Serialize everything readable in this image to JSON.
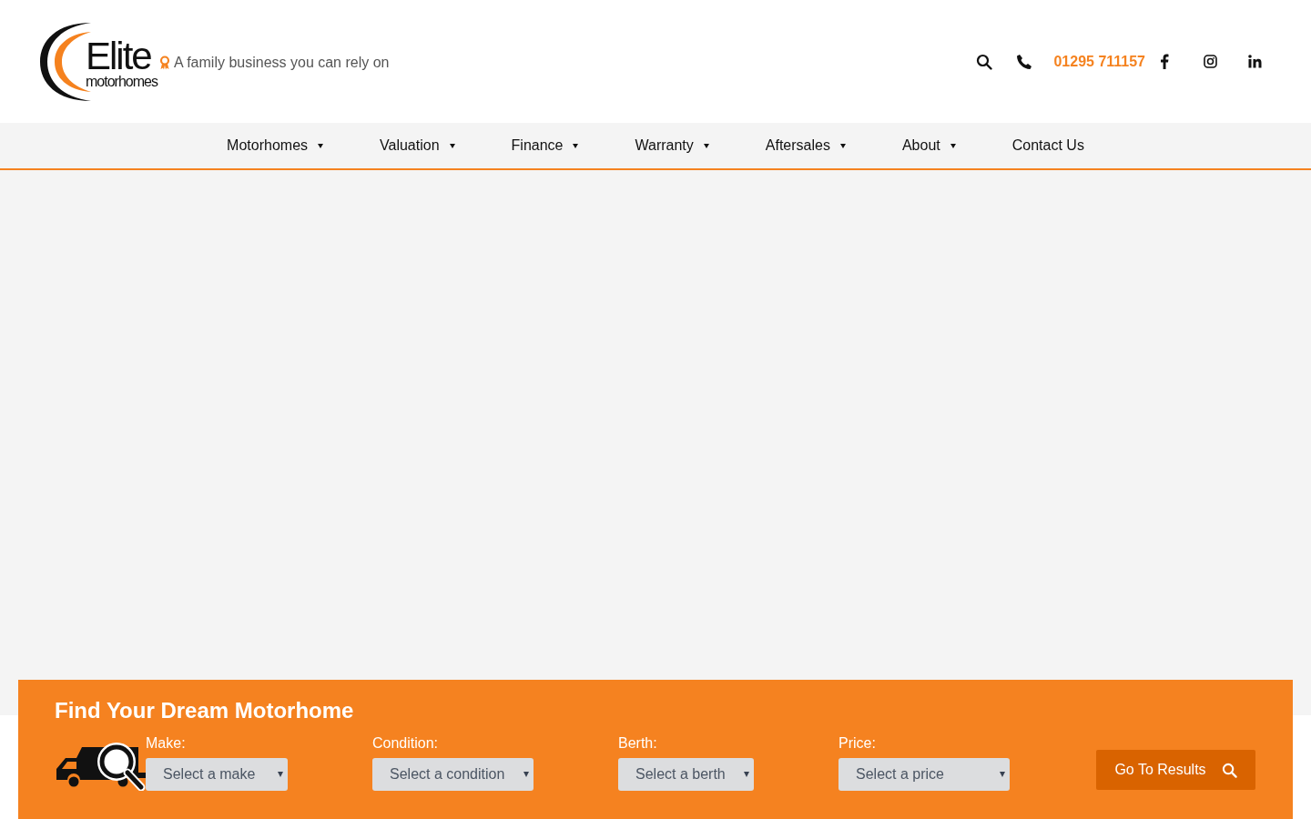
{
  "logo": {
    "wordmark": "Elite",
    "subline": "motorhomes"
  },
  "tagline": "A family business you can rely on",
  "contact": {
    "phone": "01295 711157"
  },
  "nav": [
    {
      "label": "Motorhomes",
      "dropdown": true
    },
    {
      "label": "Valuation",
      "dropdown": true
    },
    {
      "label": "Finance",
      "dropdown": true
    },
    {
      "label": "Warranty",
      "dropdown": true
    },
    {
      "label": "Aftersales",
      "dropdown": true
    },
    {
      "label": "About",
      "dropdown": true
    },
    {
      "label": "Contact Us",
      "dropdown": false
    }
  ],
  "search_panel": {
    "title": "Find Your Dream Motorhome",
    "filters": [
      {
        "label": "Make:",
        "placeholder": "Select a make"
      },
      {
        "label": "Condition:",
        "placeholder": "Select a condition"
      },
      {
        "label": "Berth:",
        "placeholder": "Select a berth"
      },
      {
        "label": "Price:",
        "placeholder": "Select a price"
      }
    ],
    "button": "Go To Results"
  }
}
